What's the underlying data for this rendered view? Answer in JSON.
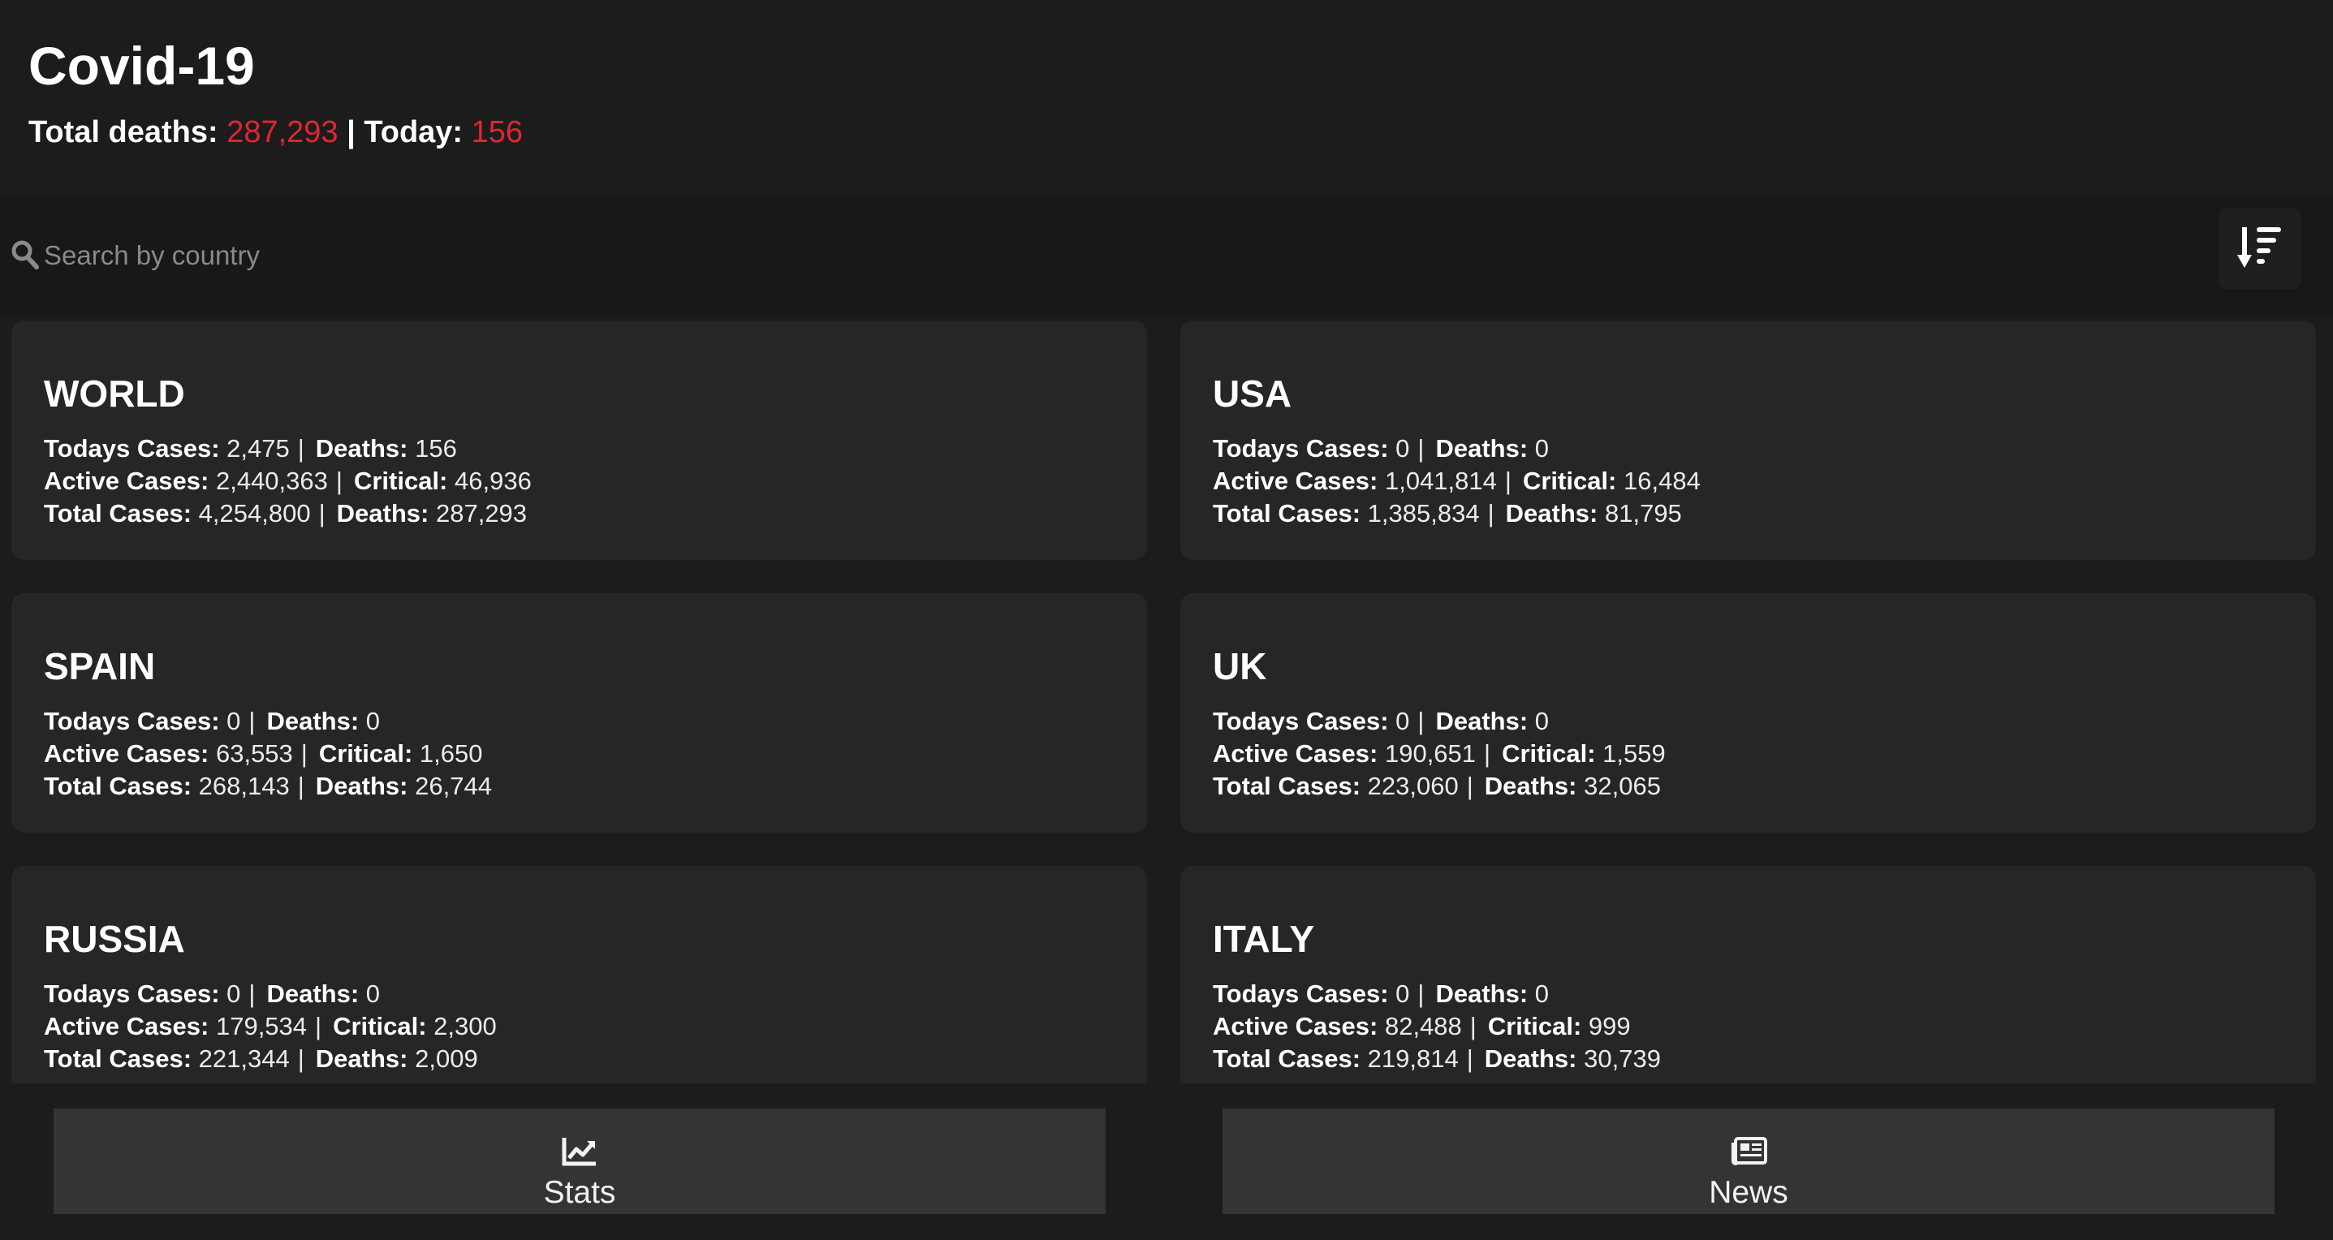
{
  "header": {
    "title": "Covid-19",
    "total_deaths_label": "Total deaths:",
    "total_deaths_value": "287,293",
    "separator": "|",
    "today_label": "Today:",
    "today_value": "156",
    "highlight_color": "#e02633"
  },
  "search": {
    "placeholder": "Search by country",
    "value": "",
    "icon": "search-icon"
  },
  "sort_button": {
    "icon": "sort-descending-icon"
  },
  "labels": {
    "todays_cases": "Todays Cases:",
    "deaths": "Deaths:",
    "active_cases": "Active Cases:",
    "critical": "Critical:",
    "total_cases": "Total Cases:",
    "separator": "|"
  },
  "countries": [
    {
      "name": "WORLD",
      "todays_cases": "2,475",
      "todays_deaths": "156",
      "active_cases": "2,440,363",
      "critical": "46,936",
      "total_cases": "4,254,800",
      "total_deaths": "287,293"
    },
    {
      "name": "USA",
      "todays_cases": "0",
      "todays_deaths": "0",
      "active_cases": "1,041,814",
      "critical": "16,484",
      "total_cases": "1,385,834",
      "total_deaths": "81,795"
    },
    {
      "name": "SPAIN",
      "todays_cases": "0",
      "todays_deaths": "0",
      "active_cases": "63,553",
      "critical": "1,650",
      "total_cases": "268,143",
      "total_deaths": "26,744"
    },
    {
      "name": "UK",
      "todays_cases": "0",
      "todays_deaths": "0",
      "active_cases": "190,651",
      "critical": "1,559",
      "total_cases": "223,060",
      "total_deaths": "32,065"
    },
    {
      "name": "RUSSIA",
      "todays_cases": "0",
      "todays_deaths": "0",
      "active_cases": "179,534",
      "critical": "2,300",
      "total_cases": "221,344",
      "total_deaths": "2,009"
    },
    {
      "name": "ITALY",
      "todays_cases": "0",
      "todays_deaths": "0",
      "active_cases": "82,488",
      "critical": "999",
      "total_cases": "219,814",
      "total_deaths": "30,739"
    }
  ],
  "bottom_nav": [
    {
      "label": "Stats",
      "icon": "chart-line-icon"
    },
    {
      "label": "News",
      "icon": "newspaper-icon"
    }
  ]
}
